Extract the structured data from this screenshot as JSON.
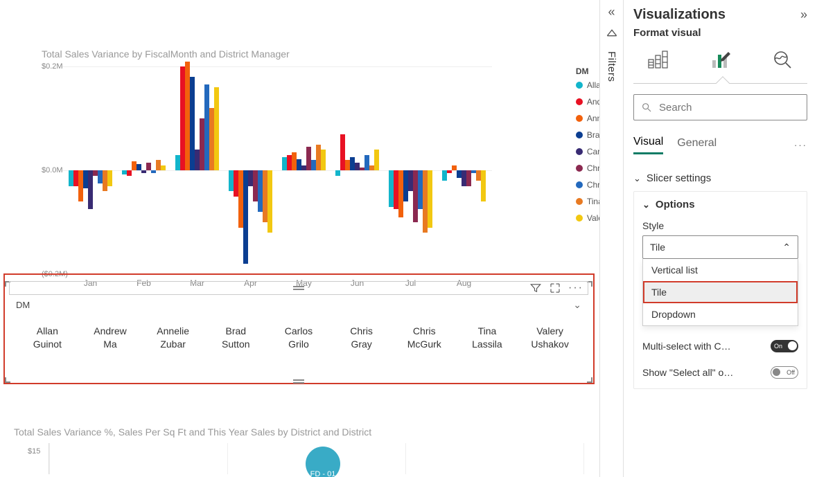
{
  "titles": {
    "chart1": "Total Sales Variance by FiscalMonth and District Manager",
    "chart2": "Total Sales Variance %, Sales Per Sq Ft and This Year Sales by District and District"
  },
  "months": [
    "Jan",
    "Feb",
    "Mar",
    "Apr",
    "May",
    "Jun",
    "Jul",
    "Aug"
  ],
  "yticks": [
    "$0.2M",
    "$0.0M",
    "($0.2M)"
  ],
  "legend_title": "DM",
  "managers": [
    {
      "name": "Allan Guinot",
      "color": "#12b5cb"
    },
    {
      "name": "Andrew Ma",
      "color": "#e81123"
    },
    {
      "name": "Annelie Zubar",
      "color": "#f2610c"
    },
    {
      "name": "Brad Sutton",
      "color": "#0b3e91"
    },
    {
      "name": "Carlos Grilo",
      "color": "#382b73"
    },
    {
      "name": "Chris Gray",
      "color": "#8b2950"
    },
    {
      "name": "Chris McGurk",
      "color": "#2369bd"
    },
    {
      "name": "Tina Lassila",
      "color": "#e87a22"
    },
    {
      "name": "Valery Ushakov",
      "color": "#f2c811"
    }
  ],
  "chart_data": {
    "type": "bar",
    "title": "Total Sales Variance by FiscalMonth and District Manager",
    "ylabel": "Total Sales Variance",
    "ylim": [
      -0.2,
      0.2
    ],
    "yunit": "$M",
    "categories": [
      "Jan",
      "Feb",
      "Mar",
      "Apr",
      "May",
      "Jun",
      "Jul",
      "Aug"
    ],
    "series": [
      {
        "name": "Allan Guinot",
        "color": "#12b5cb",
        "values": [
          -0.03,
          -0.008,
          0.03,
          -0.04,
          0.025,
          -0.01,
          -0.07,
          -0.02
        ]
      },
      {
        "name": "Andrew Ma",
        "color": "#e81123",
        "values": [
          -0.03,
          -0.01,
          0.2,
          -0.05,
          0.03,
          0.07,
          -0.075,
          -0.005
        ]
      },
      {
        "name": "Annelie Zubar",
        "color": "#f2610c",
        "values": [
          -0.06,
          0.018,
          0.21,
          -0.11,
          0.035,
          0.02,
          -0.09,
          0.01
        ]
      },
      {
        "name": "Brad Sutton",
        "color": "#0b3e91",
        "values": [
          -0.035,
          0.012,
          0.18,
          -0.18,
          0.022,
          0.025,
          -0.06,
          -0.015
        ]
      },
      {
        "name": "Carlos Grilo",
        "color": "#382b73",
        "values": [
          -0.075,
          -0.005,
          0.04,
          -0.03,
          0.01,
          0.015,
          -0.04,
          -0.03
        ]
      },
      {
        "name": "Chris Gray",
        "color": "#8b2950",
        "values": [
          -0.01,
          0.015,
          0.1,
          -0.06,
          0.045,
          0.005,
          -0.1,
          -0.03
        ]
      },
      {
        "name": "Chris McGurk",
        "color": "#2369bd",
        "values": [
          -0.025,
          -0.005,
          0.165,
          -0.08,
          0.02,
          0.03,
          -0.075,
          -0.005
        ]
      },
      {
        "name": "Tina Lassila",
        "color": "#e87a22",
        "values": [
          -0.04,
          0.02,
          0.12,
          -0.1,
          0.05,
          0.01,
          -0.12,
          -0.02
        ]
      },
      {
        "name": "Valery Ushakov",
        "color": "#f2c811",
        "values": [
          -0.03,
          0.01,
          0.16,
          -0.12,
          0.04,
          0.04,
          -0.11,
          -0.06
        ]
      }
    ]
  },
  "slicer": {
    "field": "DM",
    "tiles": [
      "Allan Guinot",
      "Andrew Ma",
      "Annelie Zubar",
      "Brad Sutton",
      "Carlos Grilo",
      "Chris Gray",
      "Chris McGurk",
      "Tina Lassila",
      "Valery Ushakov"
    ]
  },
  "chart2": {
    "ytick": "$15",
    "bubble_label": "FD - 01"
  },
  "filters_label": "Filters",
  "panel": {
    "title": "Visualizations",
    "subtitle": "Format visual",
    "search_placeholder": "Search",
    "tabs": {
      "visual": "Visual",
      "general": "General"
    },
    "slicer_settings": "Slicer settings",
    "options": "Options",
    "style_label": "Style",
    "style_value": "Tile",
    "style_options": [
      "Vertical list",
      "Tile",
      "Dropdown"
    ],
    "multiselect": "Multi-select with C…",
    "selectall": "Show \"Select all\" o…",
    "on": "On",
    "off": "Off"
  }
}
